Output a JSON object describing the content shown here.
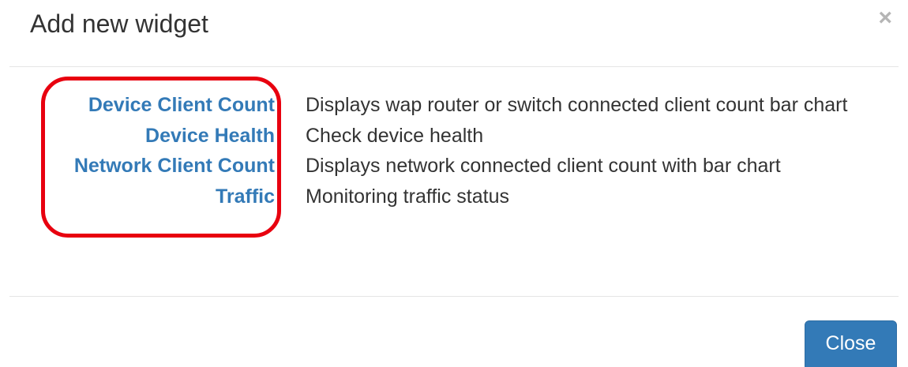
{
  "dialog": {
    "title": "Add new widget",
    "close_icon_glyph": "×",
    "close_icon": "close-icon"
  },
  "widgets": [
    {
      "name": "Device Client Count",
      "description": "Displays wap router or switch connected client count bar chart"
    },
    {
      "name": "Device Health",
      "description": "Check device health"
    },
    {
      "name": "Network Client Count",
      "description": "Displays network connected client count with bar chart"
    },
    {
      "name": "Traffic",
      "description": "Monitoring traffic status"
    }
  ],
  "footer": {
    "close_button_label": "Close"
  },
  "colors": {
    "link": "#337ab7",
    "primary_button": "#337ab7",
    "highlight_annotation": "#e8000f",
    "text": "#333333"
  }
}
